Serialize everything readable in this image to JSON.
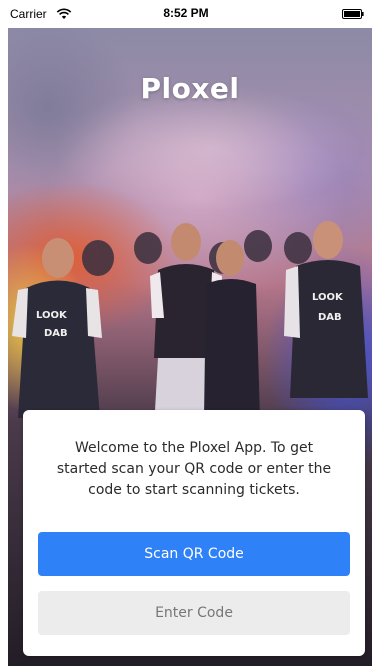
{
  "status_bar": {
    "carrier": "Carrier",
    "time": "8:52 PM",
    "icons": [
      "wifi-icon",
      "battery-icon"
    ]
  },
  "app": {
    "name": "Ploxel"
  },
  "welcome_card": {
    "message": "Welcome to the Ploxel App. To get started scan your QR code or enter the code to start scanning tickets.",
    "scan_button_label": "Scan QR Code",
    "enter_code_button_label": "Enter Code"
  },
  "colors": {
    "primary_button": "#2f81f7",
    "secondary_button": "#ececec",
    "secondary_button_text": "#777777",
    "card_background": "#ffffff"
  }
}
